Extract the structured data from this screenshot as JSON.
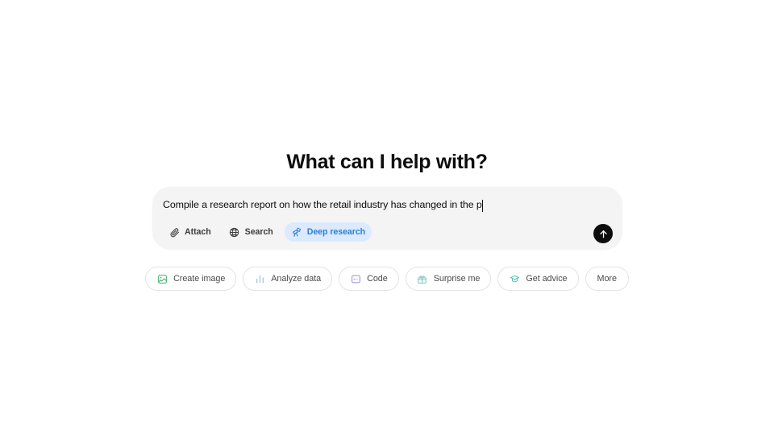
{
  "page": {
    "background_color": "#ffffff",
    "heading": "What can I help with?"
  },
  "composer": {
    "background_color": "#f4f4f4",
    "input_value": "Compile a research report on how the retail industry has changed in the p",
    "caret_visible": true,
    "send_button": {
      "label": "Send",
      "icon": "arrow-up-icon",
      "background_color": "#0d0d0d",
      "icon_color": "#ffffff"
    },
    "tools": [
      {
        "id": "attach",
        "label": "Attach",
        "icon": "paperclip-icon",
        "active": false,
        "text_color": "#3d3d3d"
      },
      {
        "id": "search",
        "label": "Search",
        "icon": "globe-icon",
        "active": false,
        "text_color": "#3d3d3d"
      },
      {
        "id": "deep-research",
        "label": "Deep research",
        "icon": "telescope-icon",
        "active": true,
        "text_color": "#2f7fd4",
        "background_color": "#dbeafe"
      }
    ]
  },
  "suggestions": [
    {
      "id": "create-image",
      "label": "Create image",
      "icon": "image-icon",
      "icon_color": "#4caf6e"
    },
    {
      "id": "analyze-data",
      "label": "Analyze data",
      "icon": "bar-chart-icon",
      "icon_color": "#8fbde0"
    },
    {
      "id": "code",
      "label": "Code",
      "icon": "code-window-icon",
      "icon_color": "#9b8fd6"
    },
    {
      "id": "surprise-me",
      "label": "Surprise me",
      "icon": "gift-icon",
      "icon_color": "#7fc8c3"
    },
    {
      "id": "get-advice",
      "label": "Get advice",
      "icon": "graduation-cap-icon",
      "icon_color": "#5fc0b5"
    },
    {
      "id": "more",
      "label": "More",
      "icon": null,
      "icon_color": null
    }
  ]
}
